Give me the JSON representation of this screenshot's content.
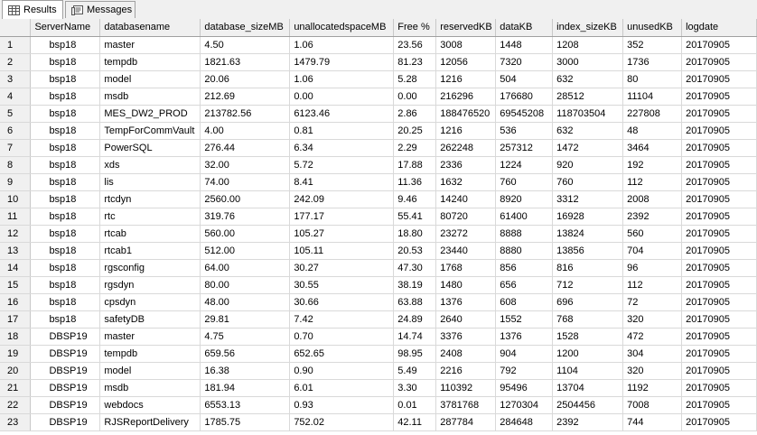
{
  "tabs": {
    "results_label": "Results",
    "messages_label": "Messages",
    "results_icon": "grid-icon",
    "messages_icon": "messages-icon"
  },
  "columns": [
    "ServerName",
    "databasename",
    "database_sizeMB",
    "unallocatedspaceMB",
    "Free %",
    "reservedKB",
    "dataKB",
    "index_sizeKB",
    "unusedKB",
    "logdate"
  ],
  "rows": [
    {
      "n": "1",
      "cells": [
        "bsp18",
        "master",
        "4.50",
        "1.06",
        "23.56",
        "3008",
        "1448",
        "1208",
        "352",
        "20170905"
      ]
    },
    {
      "n": "2",
      "cells": [
        "bsp18",
        "tempdb",
        "1821.63",
        "1479.79",
        "81.23",
        "12056",
        "7320",
        "3000",
        "1736",
        "20170905"
      ]
    },
    {
      "n": "3",
      "cells": [
        "bsp18",
        "model",
        "20.06",
        "1.06",
        "5.28",
        "1216",
        "504",
        "632",
        "80",
        "20170905"
      ]
    },
    {
      "n": "4",
      "cells": [
        "bsp18",
        "msdb",
        "212.69",
        "0.00",
        "0.00",
        "216296",
        "176680",
        "28512",
        "11104",
        "20170905"
      ]
    },
    {
      "n": "5",
      "cells": [
        "bsp18",
        "MES_DW2_PROD",
        "213782.56",
        "6123.46",
        "2.86",
        "188476520",
        "69545208",
        "118703504",
        "227808",
        "20170905"
      ]
    },
    {
      "n": "6",
      "cells": [
        "bsp18",
        "TempForCommVault",
        "4.00",
        "0.81",
        "20.25",
        "1216",
        "536",
        "632",
        "48",
        "20170905"
      ]
    },
    {
      "n": "7",
      "cells": [
        "bsp18",
        "PowerSQL",
        "276.44",
        "6.34",
        "2.29",
        "262248",
        "257312",
        "1472",
        "3464",
        "20170905"
      ]
    },
    {
      "n": "8",
      "cells": [
        "bsp18",
        "xds",
        "32.00",
        "5.72",
        "17.88",
        "2336",
        "1224",
        "920",
        "192",
        "20170905"
      ]
    },
    {
      "n": "9",
      "cells": [
        "bsp18",
        "lis",
        "74.00",
        "8.41",
        "11.36",
        "1632",
        "760",
        "760",
        "112",
        "20170905"
      ]
    },
    {
      "n": "10",
      "cells": [
        "bsp18",
        "rtcdyn",
        "2560.00",
        "242.09",
        "9.46",
        "14240",
        "8920",
        "3312",
        "2008",
        "20170905"
      ]
    },
    {
      "n": "11",
      "cells": [
        "bsp18",
        "rtc",
        "319.76",
        "177.17",
        "55.41",
        "80720",
        "61400",
        "16928",
        "2392",
        "20170905"
      ]
    },
    {
      "n": "12",
      "cells": [
        "bsp18",
        "rtcab",
        "560.00",
        "105.27",
        "18.80",
        "23272",
        "8888",
        "13824",
        "560",
        "20170905"
      ]
    },
    {
      "n": "13",
      "cells": [
        "bsp18",
        "rtcab1",
        "512.00",
        "105.11",
        "20.53",
        "23440",
        "8880",
        "13856",
        "704",
        "20170905"
      ]
    },
    {
      "n": "14",
      "cells": [
        "bsp18",
        "rgsconfig",
        "64.00",
        "30.27",
        "47.30",
        "1768",
        "856",
        "816",
        "96",
        "20170905"
      ]
    },
    {
      "n": "15",
      "cells": [
        "bsp18",
        "rgsdyn",
        "80.00",
        "30.55",
        "38.19",
        "1480",
        "656",
        "712",
        "112",
        "20170905"
      ]
    },
    {
      "n": "16",
      "cells": [
        "bsp18",
        "cpsdyn",
        "48.00",
        "30.66",
        "63.88",
        "1376",
        "608",
        "696",
        "72",
        "20170905"
      ]
    },
    {
      "n": "17",
      "cells": [
        "bsp18",
        "safetyDB",
        "29.81",
        "7.42",
        "24.89",
        "2640",
        "1552",
        "768",
        "320",
        "20170905"
      ]
    },
    {
      "n": "18",
      "cells": [
        "DBSP19",
        "master",
        "4.75",
        "0.70",
        "14.74",
        "3376",
        "1376",
        "1528",
        "472",
        "20170905"
      ]
    },
    {
      "n": "19",
      "cells": [
        "DBSP19",
        "tempdb",
        "659.56",
        "652.65",
        "98.95",
        "2408",
        "904",
        "1200",
        "304",
        "20170905"
      ]
    },
    {
      "n": "20",
      "cells": [
        "DBSP19",
        "model",
        "16.38",
        "0.90",
        "5.49",
        "2216",
        "792",
        "1104",
        "320",
        "20170905"
      ]
    },
    {
      "n": "21",
      "cells": [
        "DBSP19",
        "msdb",
        "181.94",
        "6.01",
        "3.30",
        "110392",
        "95496",
        "13704",
        "1192",
        "20170905"
      ]
    },
    {
      "n": "22",
      "cells": [
        "DBSP19",
        "webdocs",
        "6553.13",
        "0.93",
        "0.01",
        "3781768",
        "1270304",
        "2504456",
        "7008",
        "20170905"
      ]
    },
    {
      "n": "23",
      "cells": [
        "DBSP19",
        "RJSReportDelivery",
        "1785.75",
        "752.02",
        "42.11",
        "287784",
        "284648",
        "2392",
        "744",
        "20170905"
      ]
    }
  ]
}
